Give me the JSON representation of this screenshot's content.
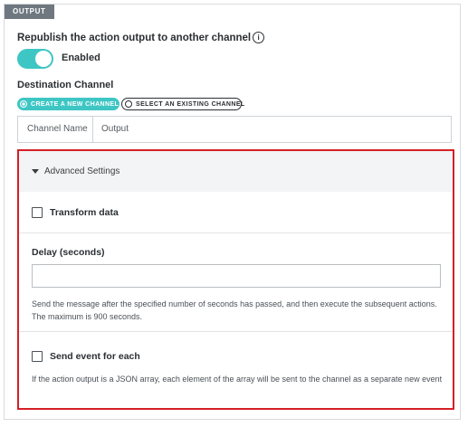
{
  "section": {
    "tag": "OUTPUT"
  },
  "republish": {
    "label": "Republish the action output to another channel",
    "info_icon_glyph": "i",
    "toggle_state": "on",
    "toggle_label": "Enabled"
  },
  "destination": {
    "label": "Destination Channel",
    "options": [
      {
        "label": "CREATE A NEW CHANNEL",
        "selected": true
      },
      {
        "label": "SELECT AN EXISTING CHANNEL",
        "selected": false
      }
    ],
    "channel_name_label": "Channel Name",
    "channel_name_value": "Output"
  },
  "advanced": {
    "header": "Advanced Settings",
    "transform": {
      "label": "Transform data",
      "checked": false
    },
    "delay": {
      "label": "Delay (seconds)",
      "value": "",
      "help": "Send the message after the specified number of seconds has passed, and then execute the subsequent actions. The maximum is 900 seconds."
    },
    "send_each": {
      "label": "Send event for each",
      "checked": false,
      "help": "If the action output is a JSON array, each element of the array will be sent to the channel as a separate new event"
    }
  },
  "colors": {
    "accent": "#3ec6c4",
    "highlight_border": "#d51f26",
    "tag_bg": "#6f7880"
  }
}
